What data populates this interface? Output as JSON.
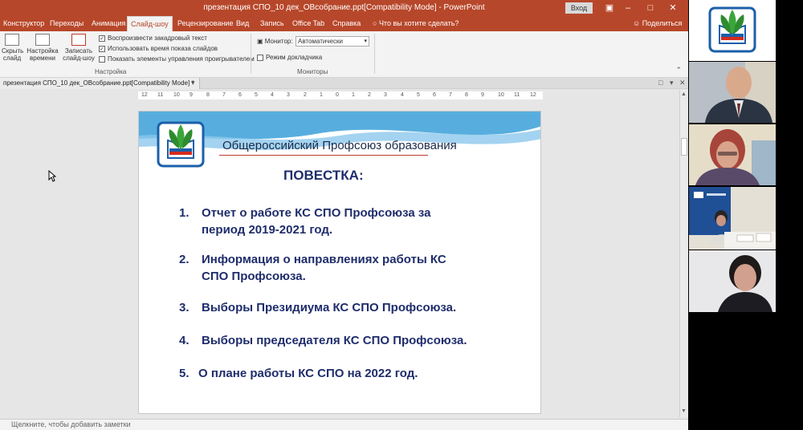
{
  "window": {
    "title": "презентация СПО_10 дек_ОВсобрание.ppt[Compatibility Mode]  -  PowerPoint",
    "signin": "Вход"
  },
  "tabs": [
    {
      "label": "Конструктор"
    },
    {
      "label": "Переходы"
    },
    {
      "label": "Анимация"
    },
    {
      "label": "Слайд-шоу"
    },
    {
      "label": "Рецензирование"
    },
    {
      "label": "Вид"
    },
    {
      "label": "Запись"
    },
    {
      "label": "Office Tab"
    },
    {
      "label": "Справка"
    }
  ],
  "tellme": "Что вы хотите сделать?",
  "share": "Поделиться",
  "ribbon": {
    "hide_slide": "Скрыть слайд",
    "rehearse": "Настройка времени",
    "record": "Записать слайд-шоу",
    "check_narration": "Воспроизвести закадровый текст",
    "check_timings": "Использовать время показа слайдов",
    "check_controls": "Показать элементы управления проигрывателем",
    "group_setup": "Настройка",
    "monitor_label": "Монитор:",
    "monitor_value": "Автоматически",
    "presenter_view": "Режим докладчика",
    "group_monitors": "Мониторы"
  },
  "doc_tab": "презентация СПО_10 дек_ОВсобрание.ppt[Compatibility Mode] *",
  "ruler": [
    "12",
    "11",
    "10",
    "9",
    "8",
    "7",
    "6",
    "5",
    "4",
    "3",
    "2",
    "1",
    "0",
    "1",
    "2",
    "3",
    "4",
    "5",
    "6",
    "7",
    "8",
    "9",
    "10",
    "11",
    "12"
  ],
  "slide": {
    "organization": "Общероссийский Профсоюз образования",
    "heading": "ПОВЕСТКА:",
    "items": [
      {
        "num": "1.",
        "line1": "Отчет о работе КС СПО Профсоюза за",
        "line2": "период 2019-2021 год."
      },
      {
        "num": "2.",
        "line1": "Информация о направлениях работы КС",
        "line2": "СПО Профсоюза."
      },
      {
        "num": "3.",
        "line1": "Выборы Президиума КС СПО Профсоюза.",
        "line2": ""
      },
      {
        "num": "4.",
        "line1": "Выборы председателя КС СПО Профсоюза.",
        "line2": ""
      },
      {
        "num": "5.",
        "line1": "О плане работы КС СПО на 2022 год.",
        "line2": ""
      }
    ]
  },
  "notes_placeholder": "Щелкните, чтобы добавить заметки",
  "colors": {
    "brand": "#b7472a",
    "slide_text": "#1f2d6b",
    "wave": "#3aa0d8"
  }
}
